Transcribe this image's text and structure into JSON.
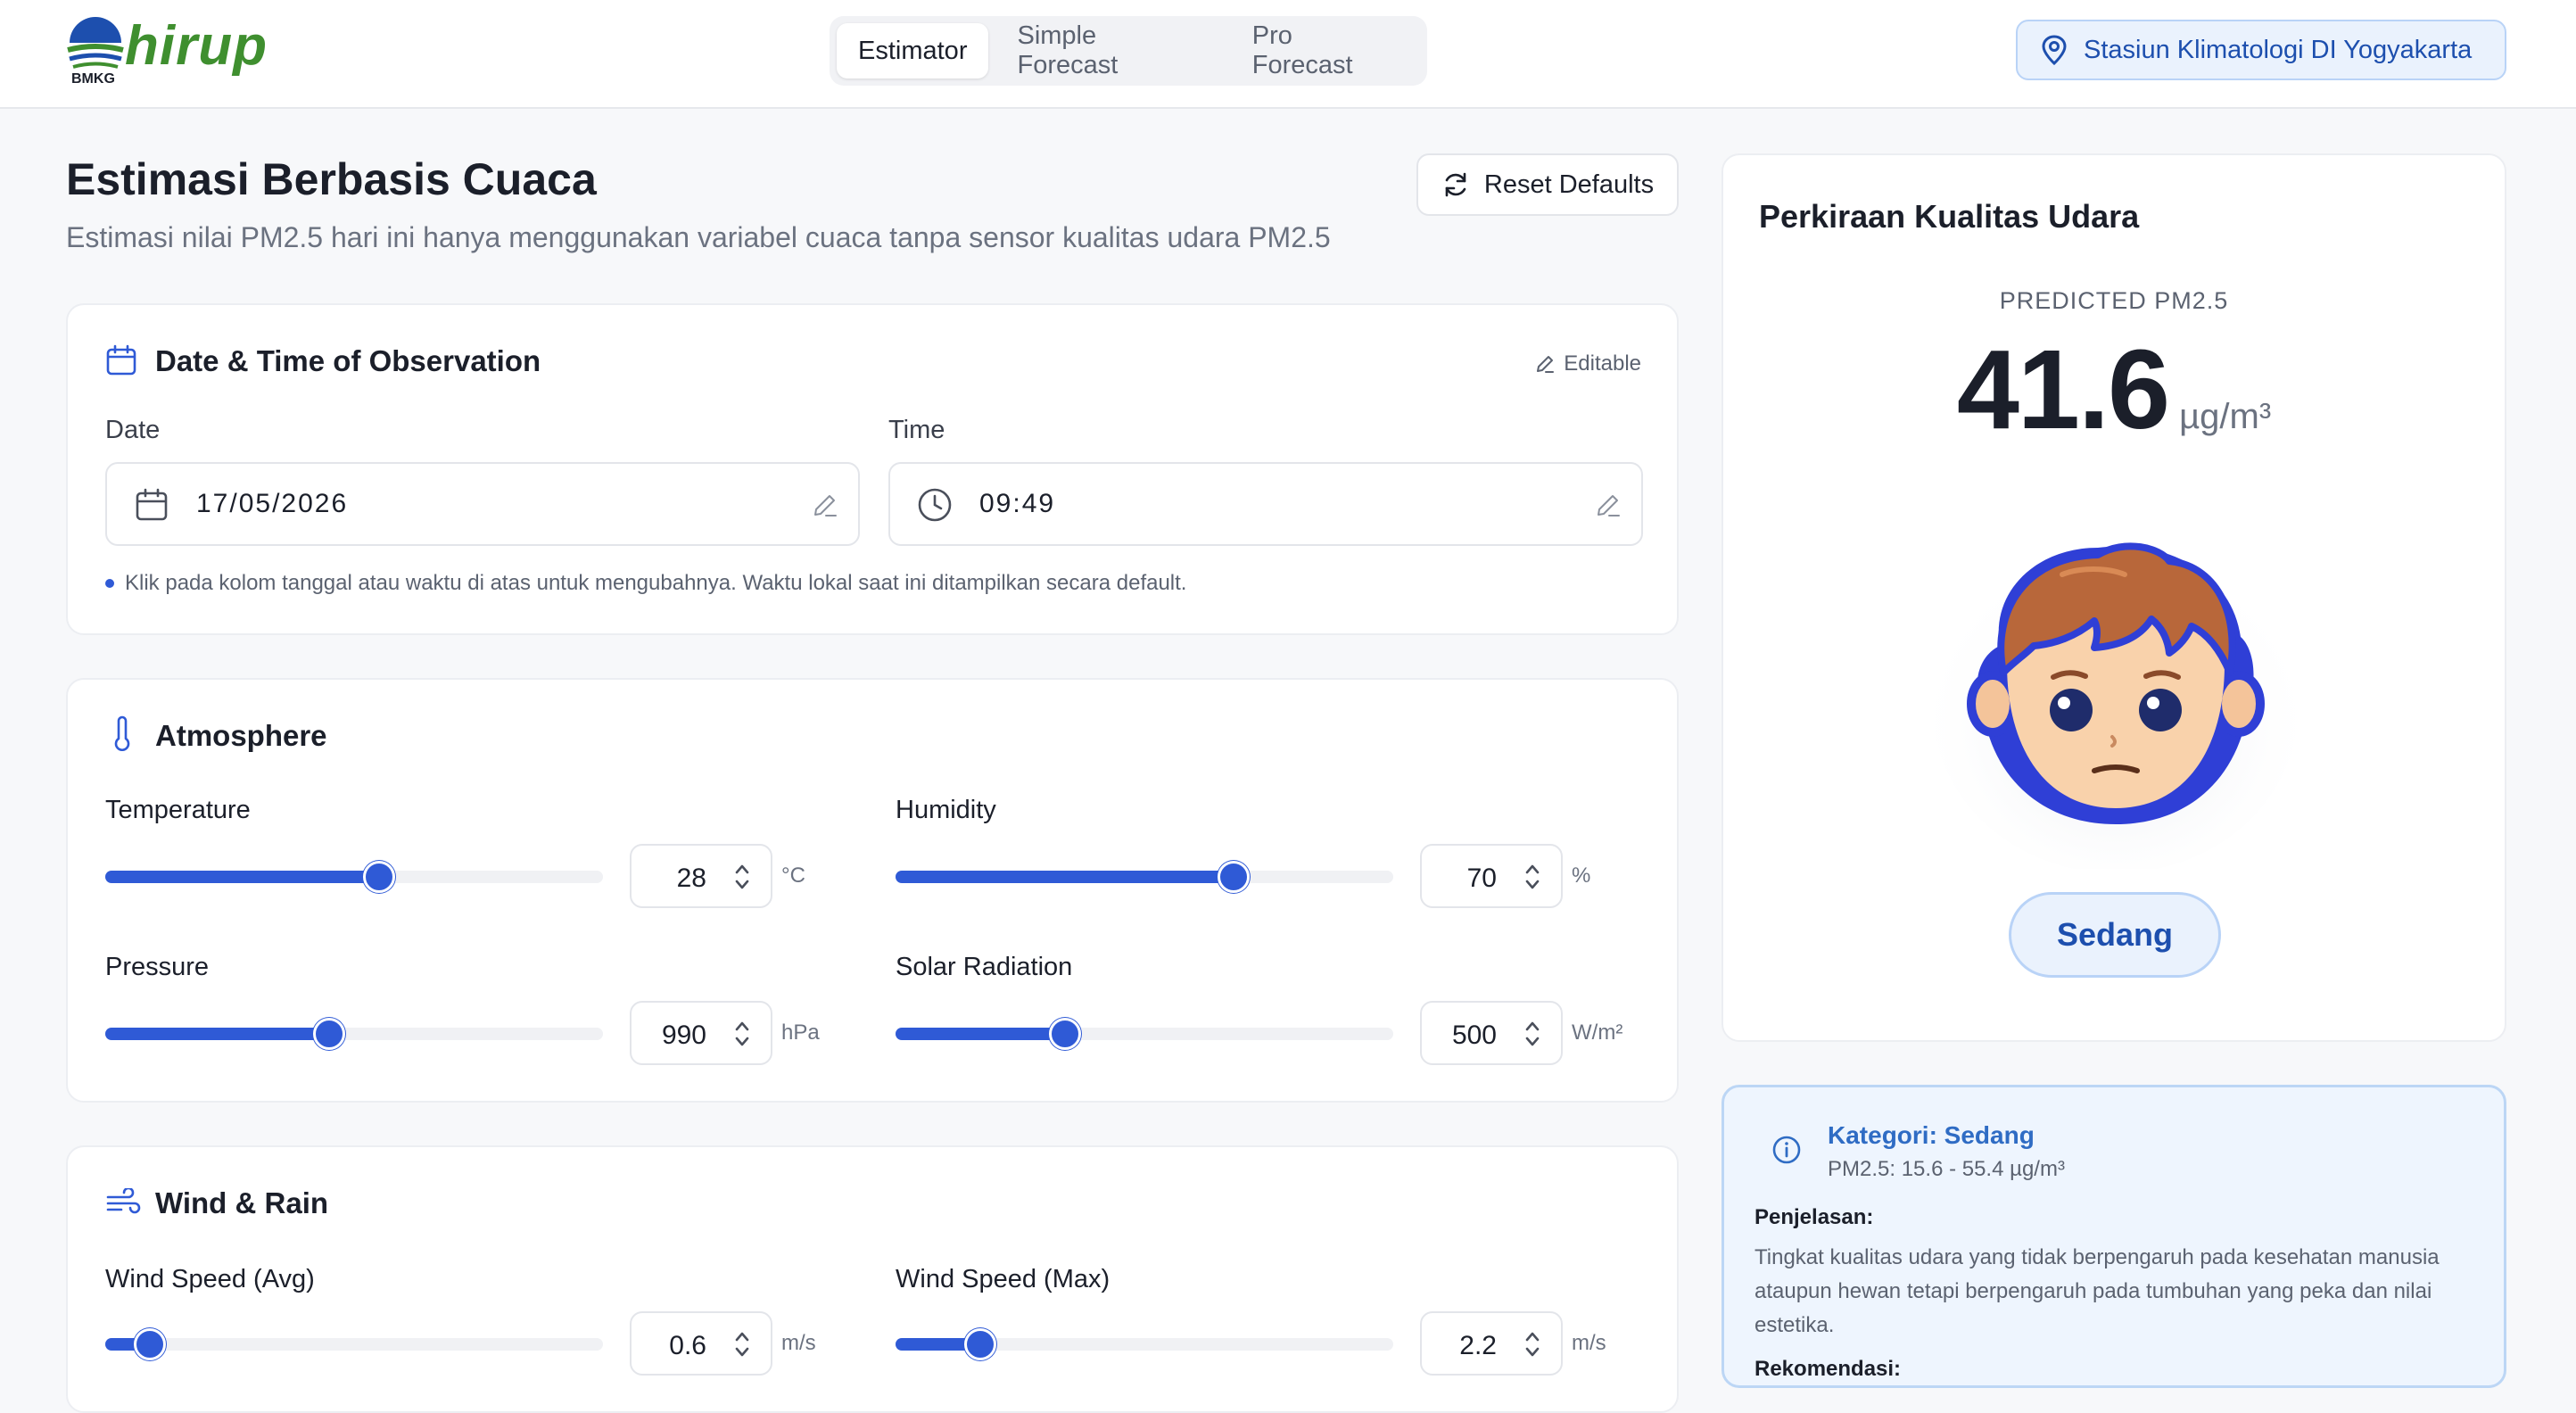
{
  "header": {
    "logo_text": "hirup",
    "logo_sub": "BMKG",
    "tabs": [
      "Estimator",
      "Simple Forecast",
      "Pro Forecast"
    ],
    "active_tab": "Estimator",
    "station": "Stasiun Klimatologi DI Yogyakarta"
  },
  "page": {
    "title": "Estimasi Berbasis Cuaca",
    "subtitle": "Estimasi nilai PM2.5 hari ini hanya menggunakan variabel cuaca tanpa sensor kualitas udara PM2.5",
    "reset_label": "Reset Defaults"
  },
  "datetime": {
    "title": "Date & Time of Observation",
    "editable": "Editable",
    "date_label": "Date",
    "date_value": "17/05/2026",
    "time_label": "Time",
    "time_value": "09:49",
    "hint": "Klik pada kolom tanggal atau waktu di atas untuk mengubahnya. Waktu lokal saat ini ditampilkan secara default."
  },
  "atmosphere": {
    "title": "Atmosphere",
    "temperature": {
      "label": "Temperature",
      "value": "28",
      "unit": "°C",
      "level": 0.55
    },
    "humidity": {
      "label": "Humidity",
      "value": "70",
      "unit": "%",
      "level": 0.68
    },
    "pressure": {
      "label": "Pressure",
      "value": "990",
      "unit": "hPa",
      "level": 0.45
    },
    "solar": {
      "label": "Solar Radiation",
      "value": "500",
      "unit": "W/m²",
      "level": 0.34
    }
  },
  "wind": {
    "title": "Wind & Rain",
    "avg": {
      "label": "Wind Speed (Avg)",
      "value": "0.6",
      "unit": "m/s",
      "level": 0.09
    },
    "max": {
      "label": "Wind Speed (Max)",
      "value": "2.2",
      "unit": "m/s",
      "level": 0.17
    }
  },
  "prediction": {
    "title": "Perkiraan Kualitas Udara",
    "label": "PREDICTED PM2.5",
    "value": "41.6",
    "unit": "µg/m³",
    "category": "Sedang"
  },
  "info": {
    "title": "Kategori: Sedang",
    "range": "PM2.5: 15.6 - 55.4 µg/m³",
    "explain_heading": "Penjelasan:",
    "explain_text": "Tingkat kualitas udara yang tidak berpengaruh pada kesehatan manusia ataupun hewan tetapi berpengaruh pada tumbuhan yang peka dan nilai estetika.",
    "recommend_heading": "Rekomendasi:"
  },
  "colors": {
    "accent": "#2f5ad6",
    "category_blue": "#1d4fae",
    "logo_green": "#3f8f2f"
  }
}
